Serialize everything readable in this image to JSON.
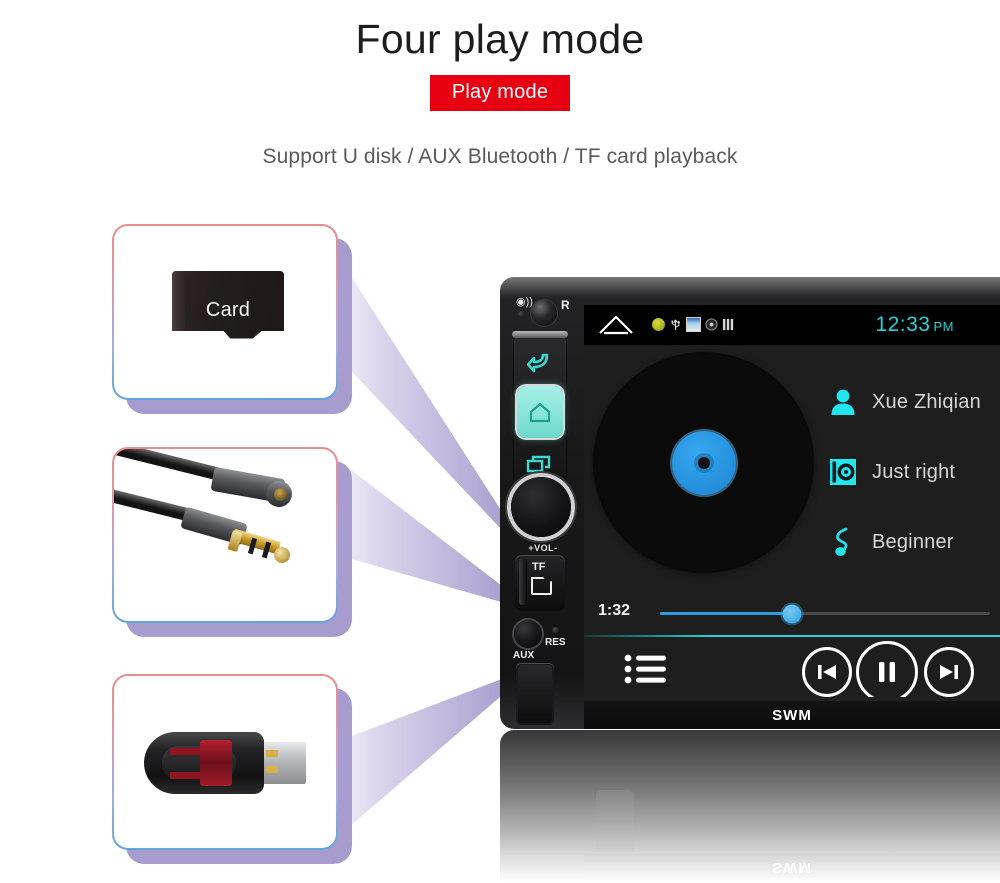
{
  "header": {
    "title": "Four play mode",
    "badge": "Play mode",
    "subtitle": "Support U disk / AUX Bluetooth / TF card playback"
  },
  "colors": {
    "badge_red": "#e60012",
    "accent_cyan": "#22d3d8",
    "accent_blue": "#2a9fe0",
    "key_cyan": "#3bd8cd",
    "border_top": "#ec8b8b",
    "border_bottom": "#63a3dc",
    "wedge_purple": "#a79ccd"
  },
  "products": [
    {
      "name": "tf-card",
      "label": "Card",
      "icon": "microsd-card-icon",
      "points_to": "tf-card-slot"
    },
    {
      "name": "aux-cable",
      "label": "",
      "icon": "aux-cable-icon",
      "points_to": "aux-jack"
    },
    {
      "name": "usb-drive",
      "label": "",
      "icon": "usb-flash-drive-icon",
      "points_to": "usb-port"
    }
  ],
  "head_unit": {
    "brand": "SWM",
    "controls": {
      "mic_icon": "microphone-icon",
      "reset_label": "",
      "ir_label": "R",
      "back_key": "back-arrow-icon",
      "home_key": "home-icon",
      "apps_key": "multitask-icon",
      "volume_label": "+VOL-",
      "tf_label": "TF",
      "tf_icon": "sd-card-icon",
      "aux_label": "AUX",
      "res_label": "RES"
    },
    "screen": {
      "status_bar": {
        "home_icon": "home-outline-icon",
        "icons": [
          "notification-badge-icon",
          "usb-icon",
          "gallery-icon",
          "disc-icon",
          "signal-bars-icon"
        ],
        "time": "12:33",
        "ampm": "PM"
      },
      "album_art": "vinyl-record-icon",
      "track": [
        {
          "icon": "person-icon",
          "label": "Xue Zhiqian"
        },
        {
          "icon": "album-icon",
          "label": "Just right"
        },
        {
          "icon": "music-note-icon",
          "label": "Beginner"
        }
      ],
      "progress": {
        "current_time": "1:32",
        "percent": 40
      },
      "controls": {
        "playlist": "playlist-icon",
        "previous": "previous-track-icon",
        "play_pause": "pause-icon",
        "next": "next-track-icon"
      }
    }
  }
}
